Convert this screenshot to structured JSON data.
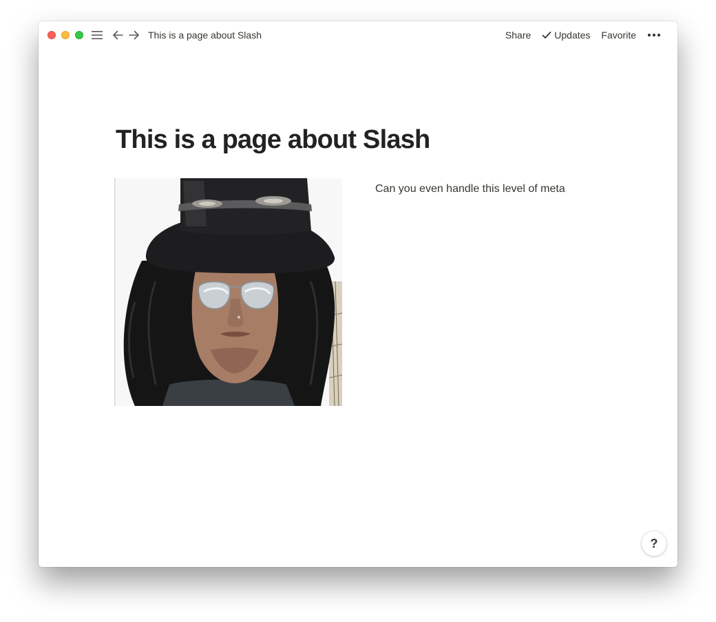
{
  "window": {
    "breadcrumb": "This is a page about Slash"
  },
  "toolbar": {
    "share_label": "Share",
    "updates_label": "Updates",
    "favorite_label": "Favorite",
    "icons": [
      "menu-icon",
      "arrow-left-icon",
      "arrow-right-icon",
      "checkmark-icon",
      "more-horizontal-icon"
    ]
  },
  "page": {
    "title": "This is a page about Slash",
    "image_subject": "photo-portrait",
    "paragraph": "Can you even handle this level of meta"
  },
  "help": {
    "label": "?"
  },
  "colors": {
    "traffic_close": "#fc605c",
    "traffic_minimize": "#fdbc40",
    "traffic_maximize": "#34c84a",
    "text": "#37352f",
    "title": "#222222"
  }
}
